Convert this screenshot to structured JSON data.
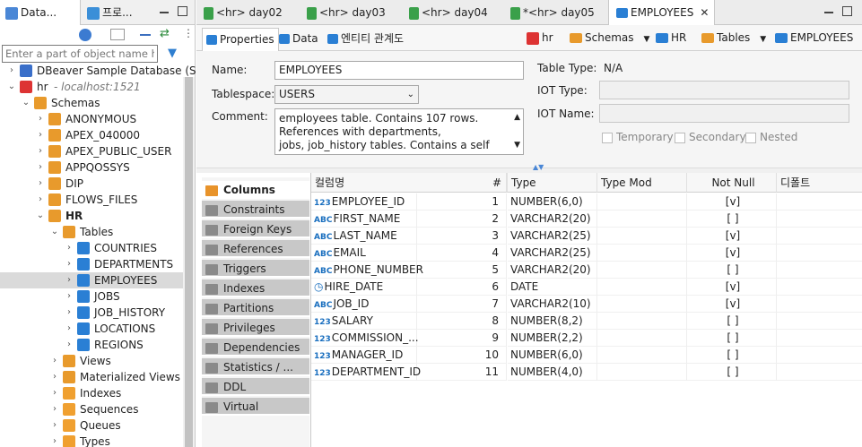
{
  "left": {
    "tabs": [
      {
        "label": "Data..."
      },
      {
        "label": "프로..."
      }
    ],
    "filter_placeholder": "Enter a part of object name here",
    "tree": [
      {
        "label": "DBeaver Sample Database (SQ",
        "depth": 0,
        "icon": "database-icon",
        "color": "#3a6fc9"
      },
      {
        "label": "hr",
        "suffix": " - localhost:1521",
        "depth": 0,
        "icon": "oracle-icon",
        "color": "#d33"
      },
      {
        "label": "Schemas",
        "depth": 1,
        "icon": "schemas-icon",
        "color": "#e89a2c"
      },
      {
        "label": "ANONYMOUS",
        "depth": 2,
        "icon": "schema-icon",
        "color": "#e89a2c"
      },
      {
        "label": "APEX_040000",
        "depth": 2,
        "icon": "schema-icon",
        "color": "#e89a2c"
      },
      {
        "label": "APEX_PUBLIC_USER",
        "depth": 2,
        "icon": "schema-icon",
        "color": "#e89a2c"
      },
      {
        "label": "APPQOSSYS",
        "depth": 2,
        "icon": "schema-icon",
        "color": "#e89a2c"
      },
      {
        "label": "DIP",
        "depth": 2,
        "icon": "schema-icon",
        "color": "#e89a2c"
      },
      {
        "label": "FLOWS_FILES",
        "depth": 2,
        "icon": "schema-icon",
        "color": "#e89a2c"
      },
      {
        "label": "HR",
        "depth": 2,
        "icon": "schema-icon",
        "color": "#e89a2c",
        "bold": true
      },
      {
        "label": "Tables",
        "depth": 3,
        "icon": "tables-folder-icon",
        "color": "#e89a2c"
      },
      {
        "label": "COUNTRIES",
        "depth": 4,
        "icon": "table-icon",
        "color": "#2a7fd4"
      },
      {
        "label": "DEPARTMENTS",
        "depth": 4,
        "icon": "table-icon",
        "color": "#2a7fd4"
      },
      {
        "label": "EMPLOYEES",
        "depth": 4,
        "icon": "table-icon",
        "color": "#2a7fd4",
        "selected": true
      },
      {
        "label": "JOBS",
        "depth": 4,
        "icon": "table-icon",
        "color": "#2a7fd4"
      },
      {
        "label": "JOB_HISTORY",
        "depth": 4,
        "icon": "table-icon",
        "color": "#2a7fd4"
      },
      {
        "label": "LOCATIONS",
        "depth": 4,
        "icon": "table-icon",
        "color": "#2a7fd4"
      },
      {
        "label": "REGIONS",
        "depth": 4,
        "icon": "table-icon",
        "color": "#2a7fd4"
      },
      {
        "label": "Views",
        "depth": 3,
        "icon": "views-folder-icon",
        "color": "#e89a2c"
      },
      {
        "label": "Materialized Views",
        "depth": 3,
        "icon": "views-folder-icon",
        "color": "#e89a2c"
      },
      {
        "label": "Indexes",
        "depth": 3,
        "icon": "folder-icon",
        "color": "#f0a030"
      },
      {
        "label": "Sequences",
        "depth": 3,
        "icon": "folder-icon",
        "color": "#f0a030"
      },
      {
        "label": "Queues",
        "depth": 3,
        "icon": "folder-icon",
        "color": "#f0a030"
      },
      {
        "label": "Types",
        "depth": 3,
        "icon": "folder-icon",
        "color": "#f0a030"
      }
    ]
  },
  "editor_tabs": [
    {
      "label": "<hr> day02"
    },
    {
      "label": "<hr> day03"
    },
    {
      "label": "<hr> day04"
    },
    {
      "label": "*<hr> day05"
    },
    {
      "label": "EMPLOYEES",
      "active": true
    }
  ],
  "sub_tabs": [
    {
      "label": "Properties",
      "active": true
    },
    {
      "label": "Data"
    },
    {
      "label": "엔티티 관계도"
    }
  ],
  "breadcrumb": [
    {
      "label": "hr"
    },
    {
      "label": "Schemas"
    },
    {
      "label": "HR"
    },
    {
      "label": "Tables"
    },
    {
      "label": "EMPLOYEES"
    }
  ],
  "props": {
    "name_label": "Name:",
    "name": "EMPLOYEES",
    "tablespace_label": "Tablespace:",
    "tablespace": "USERS",
    "comment_label": "Comment:",
    "comment_lines": [
      "employees table. Contains 107 rows.",
      "References with departments,",
      "jobs, job_history tables. Contains a self"
    ],
    "table_type_label": "Table Type:",
    "table_type": "N/A",
    "iot_type_label": "IOT Type:",
    "iot_name_label": "IOT Name:",
    "temporary": "Temporary",
    "secondary": "Secondary",
    "nested": "Nested"
  },
  "sections": [
    {
      "label": "Columns",
      "active": true
    },
    {
      "label": "Constraints"
    },
    {
      "label": "Foreign Keys"
    },
    {
      "label": "References"
    },
    {
      "label": "Triggers"
    },
    {
      "label": "Indexes"
    },
    {
      "label": "Partitions"
    },
    {
      "label": "Privileges"
    },
    {
      "label": "Dependencies"
    },
    {
      "label": "Statistics / ..."
    },
    {
      "label": "DDL"
    },
    {
      "label": "Virtual"
    }
  ],
  "columns_header": [
    "컬럼명",
    "#",
    "Type",
    "Type Mod",
    "Not Null",
    "디폴트"
  ],
  "columns": [
    {
      "type": "123",
      "name": "EMPLOYEE_ID",
      "num": "1",
      "dtype": "NUMBER(6,0)",
      "notnull": "[v]"
    },
    {
      "type": "ABC",
      "name": "FIRST_NAME",
      "num": "2",
      "dtype": "VARCHAR2(20)",
      "notnull": "[ ]"
    },
    {
      "type": "ABC",
      "name": "LAST_NAME",
      "num": "3",
      "dtype": "VARCHAR2(25)",
      "notnull": "[v]"
    },
    {
      "type": "ABC",
      "name": "EMAIL",
      "num": "4",
      "dtype": "VARCHAR2(25)",
      "notnull": "[v]"
    },
    {
      "type": "ABC",
      "name": "PHONE_NUMBER",
      "num": "5",
      "dtype": "VARCHAR2(20)",
      "notnull": "[ ]"
    },
    {
      "type": "DATE",
      "name": "HIRE_DATE",
      "num": "6",
      "dtype": "DATE",
      "notnull": "[v]"
    },
    {
      "type": "ABC",
      "name": "JOB_ID",
      "num": "7",
      "dtype": "VARCHAR2(10)",
      "notnull": "[v]"
    },
    {
      "type": "123",
      "name": "SALARY",
      "num": "8",
      "dtype": "NUMBER(8,2)",
      "notnull": "[ ]"
    },
    {
      "type": "123",
      "name": "COMMISSION_...",
      "num": "9",
      "dtype": "NUMBER(2,2)",
      "notnull": "[ ]"
    },
    {
      "type": "123",
      "name": "MANAGER_ID",
      "num": "10",
      "dtype": "NUMBER(6,0)",
      "notnull": "[ ]"
    },
    {
      "type": "123",
      "name": "DEPARTMENT_ID",
      "num": "11",
      "dtype": "NUMBER(4,0)",
      "notnull": "[ ]"
    }
  ]
}
